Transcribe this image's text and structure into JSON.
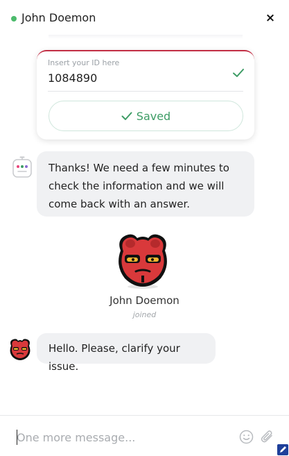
{
  "header": {
    "agent_name": "John Doemon",
    "close_label": "×",
    "status_color": "#4cbb6c"
  },
  "form": {
    "field_label": "Insert your ID here",
    "field_value": "1084890",
    "saved_label": "Saved",
    "accent_color": "#c22e44",
    "success_color": "#3d9c65"
  },
  "messages": [
    {
      "sender": "bot",
      "text": "Thanks! We need a few minutes to check the information and we will come back with an answer."
    },
    {
      "sender": "agent",
      "text": "Hello. Please, clarify your issue."
    }
  ],
  "event": {
    "name": "John Doemon",
    "status": "joined"
  },
  "composer": {
    "placeholder": "One more message..."
  },
  "icons": [
    "close-icon",
    "check-icon",
    "bot-avatar-icon",
    "emoji-icon",
    "attachment-icon"
  ]
}
